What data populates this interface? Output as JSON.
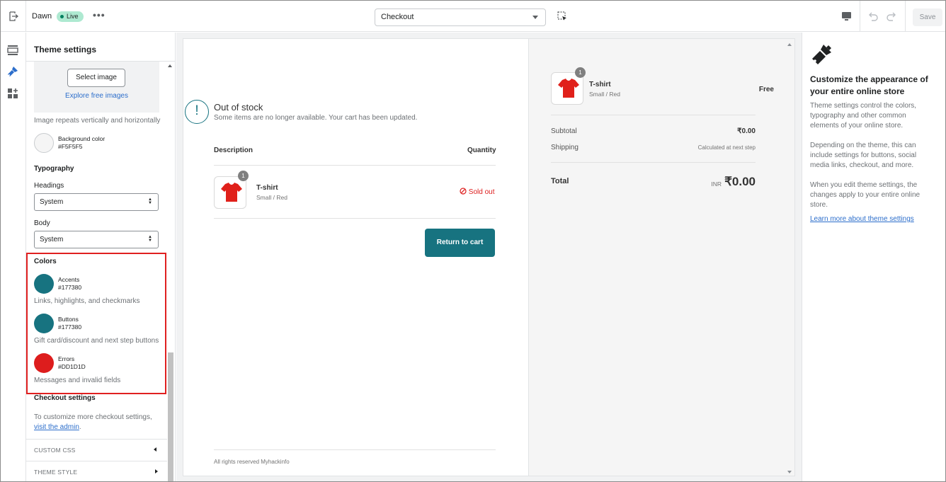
{
  "topbar": {
    "theme_name": "Dawn",
    "live_badge": "Live",
    "more_glyph": "•••",
    "page_select_value": "Checkout",
    "save_label": "Save",
    "icons": [
      "exit-icon",
      "inspect-icon",
      "desktop-icon",
      "undo-icon",
      "redo-icon"
    ]
  },
  "rail": {
    "icons": [
      "sections-icon",
      "theme-settings-icon",
      "apps-icon"
    ]
  },
  "panel": {
    "title": "Theme settings",
    "select_image_label": "Select image",
    "explore_link": "Explore free images",
    "image_repeat_help": "Image repeats vertically and horizontally",
    "background": {
      "name": "Background color",
      "hex": "#F5F5F5",
      "color": "#F5F5F5"
    },
    "typography_heading": "Typography",
    "headings_label": "Headings",
    "headings_value": "System",
    "body_label": "Body",
    "body_value": "System",
    "colors_heading": "Colors",
    "colors": [
      {
        "name": "Accents",
        "hex": "#177380",
        "color": "#177380",
        "help": "Links, highlights, and checkmarks"
      },
      {
        "name": "Buttons",
        "hex": "#177380",
        "color": "#177380",
        "help": "Gift card/discount and next step buttons"
      },
      {
        "name": "Errors",
        "hex": "#DD1D1D",
        "color": "#DD1D1D",
        "help": "Messages and invalid fields"
      }
    ],
    "checkout_heading": "Checkout settings",
    "checkout_help_prefix": "To customize more checkout settings,",
    "checkout_help_link": "visit the admin",
    "checkout_help_suffix": ".",
    "custom_css_label": "CUSTOM CSS",
    "theme_style_label": "THEME STYLE"
  },
  "preview": {
    "oos_title": "Out of stock",
    "oos_message": "Some items are no longer available. Your cart has been updated.",
    "description_header": "Description",
    "quantity_header": "Quantity",
    "item": {
      "name": "T-shirt",
      "variant": "Small / Red",
      "qty_badge": "1",
      "status": "Sold out"
    },
    "return_button": "Return to cart",
    "footer": "All rights reserved Myhackinfo",
    "summary": {
      "item_name": "T-shirt",
      "item_variant": "Small / Red",
      "item_badge": "1",
      "item_price": "Free",
      "subtotal_label": "Subtotal",
      "subtotal_value": "₹0.00",
      "shipping_label": "Shipping",
      "shipping_value": "Calculated at next step",
      "total_label": "Total",
      "total_currency": "INR",
      "total_value": "₹0.00"
    }
  },
  "info": {
    "title": "Customize the appearance of your entire online store",
    "p1": "Theme settings control the colors, typography and other common elements of your online store.",
    "p2": "Depending on the theme, this can include settings for buttons, social media links, checkout, and more.",
    "p3": "When you edit theme settings, the changes apply to your entire online store.",
    "link": "Learn more about theme settings"
  }
}
